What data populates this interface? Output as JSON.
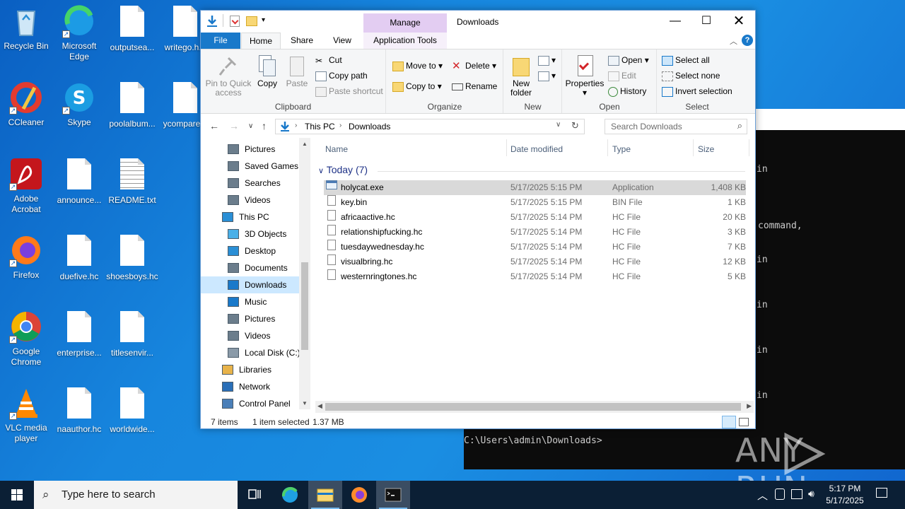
{
  "desktop": {
    "icons": [
      {
        "label": "Recycle Bin",
        "icon": "recycle-bin-icon"
      },
      {
        "label": "Microsoft Edge",
        "icon": "edge-icon"
      },
      {
        "label": "outputsea...",
        "icon": "document-icon"
      },
      {
        "label": "writego.h...",
        "icon": "document-icon"
      },
      {
        "label": "CCleaner",
        "icon": "ccleaner-icon"
      },
      {
        "label": "Skype",
        "icon": "skype-icon"
      },
      {
        "label": "poolalbum...",
        "icon": "document-icon"
      },
      {
        "label": "ycompare...",
        "icon": "document-icon"
      },
      {
        "label": "Adobe Acrobat",
        "icon": "acrobat-icon"
      },
      {
        "label": "announce...",
        "icon": "document-icon"
      },
      {
        "label": "README.txt",
        "icon": "text-file-icon"
      },
      {
        "label": "Firefox",
        "icon": "firefox-icon"
      },
      {
        "label": "duefive.hc",
        "icon": "document-icon"
      },
      {
        "label": "shoesboys.hc",
        "icon": "document-icon"
      },
      {
        "label": "Google Chrome",
        "icon": "chrome-icon"
      },
      {
        "label": "enterprise...",
        "icon": "document-icon"
      },
      {
        "label": "titlesenvir...",
        "icon": "document-icon"
      },
      {
        "label": "VLC media player",
        "icon": "vlc-icon"
      },
      {
        "label": "naauthor.hc",
        "icon": "document-icon"
      },
      {
        "label": "worldwide...",
        "icon": "document-icon"
      }
    ]
  },
  "cmd": {
    "fragments": [
      "in",
      "command,",
      "in",
      "in",
      "in",
      "in"
    ],
    "prompt": "C:\\Users\\admin\\Downloads>"
  },
  "watermark": {
    "left": "ANY",
    "right": "RUN"
  },
  "explorer": {
    "title": "Downloads",
    "manage_label": "Manage",
    "tabs": {
      "file": "File",
      "home": "Home",
      "share": "Share",
      "view": "View",
      "app_tools": "Application Tools"
    },
    "ribbon": {
      "clipboard": {
        "label": "Clipboard",
        "pin": "Pin to Quick access",
        "copy": "Copy",
        "paste": "Paste",
        "cut": "Cut",
        "copy_path": "Copy path",
        "paste_shortcut": "Paste shortcut"
      },
      "organize": {
        "label": "Organize",
        "move_to": "Move to",
        "copy_to": "Copy to",
        "delete": "Delete",
        "rename": "Rename"
      },
      "new": {
        "label": "New",
        "new_folder": "New folder"
      },
      "open": {
        "label": "Open",
        "properties": "Properties",
        "open": "Open",
        "edit": "Edit",
        "history": "History"
      },
      "select": {
        "label": "Select",
        "select_all": "Select all",
        "select_none": "Select none",
        "invert": "Invert selection"
      }
    },
    "address": {
      "segments": [
        "This PC",
        "Downloads"
      ],
      "search_placeholder": "Search Downloads"
    },
    "nav": [
      {
        "label": "Pictures",
        "icon": "pictures-icon",
        "indent": 1
      },
      {
        "label": "Saved Games",
        "icon": "saved-games-icon",
        "indent": 1
      },
      {
        "label": "Searches",
        "icon": "search-folder-icon",
        "indent": 1
      },
      {
        "label": "Videos",
        "icon": "videos-icon",
        "indent": 1
      },
      {
        "label": "This PC",
        "icon": "this-pc-icon",
        "indent": 0
      },
      {
        "label": "3D Objects",
        "icon": "3d-objects-icon",
        "indent": 1
      },
      {
        "label": "Desktop",
        "icon": "desktop-folder-icon",
        "indent": 1
      },
      {
        "label": "Documents",
        "icon": "documents-icon",
        "indent": 1
      },
      {
        "label": "Downloads",
        "icon": "downloads-icon",
        "indent": 1,
        "selected": true
      },
      {
        "label": "Music",
        "icon": "music-icon",
        "indent": 1
      },
      {
        "label": "Pictures",
        "icon": "pictures-icon",
        "indent": 1
      },
      {
        "label": "Videos",
        "icon": "videos-icon",
        "indent": 1
      },
      {
        "label": "Local Disk (C:)",
        "icon": "disk-icon",
        "indent": 1
      },
      {
        "label": "Libraries",
        "icon": "libraries-icon",
        "indent": 0
      },
      {
        "label": "Network",
        "icon": "network-icon",
        "indent": 0
      },
      {
        "label": "Control Panel",
        "icon": "control-panel-icon",
        "indent": 0
      }
    ],
    "columns": {
      "name": "Name",
      "date": "Date modified",
      "type": "Type",
      "size": "Size"
    },
    "group": "Today (7)",
    "files": [
      {
        "name": "holycat.exe",
        "date": "5/17/2025 5:15 PM",
        "type": "Application",
        "size": "1,408 KB",
        "selected": true
      },
      {
        "name": "key.bin",
        "date": "5/17/2025 5:15 PM",
        "type": "BIN File",
        "size": "1 KB"
      },
      {
        "name": "africaactive.hc",
        "date": "5/17/2025 5:14 PM",
        "type": "HC File",
        "size": "20 KB"
      },
      {
        "name": "relationshipfucking.hc",
        "date": "5/17/2025 5:14 PM",
        "type": "HC File",
        "size": "3 KB"
      },
      {
        "name": "tuesdaywednesday.hc",
        "date": "5/17/2025 5:14 PM",
        "type": "HC File",
        "size": "7 KB"
      },
      {
        "name": "visualbring.hc",
        "date": "5/17/2025 5:14 PM",
        "type": "HC File",
        "size": "12 KB"
      },
      {
        "name": "westernringtones.hc",
        "date": "5/17/2025 5:14 PM",
        "type": "HC File",
        "size": "5 KB"
      }
    ],
    "status": {
      "count": "7 items",
      "selected": "1 item selected",
      "size": "1.37 MB"
    }
  },
  "taskbar": {
    "search_placeholder": "Type here to search",
    "time": "5:17 PM",
    "date": "5/17/2025"
  },
  "colors": {
    "accent": "#1979ca",
    "manage": "#e3cdf2",
    "selection": "#cce8ff",
    "taskbar": "#0b1f35"
  }
}
